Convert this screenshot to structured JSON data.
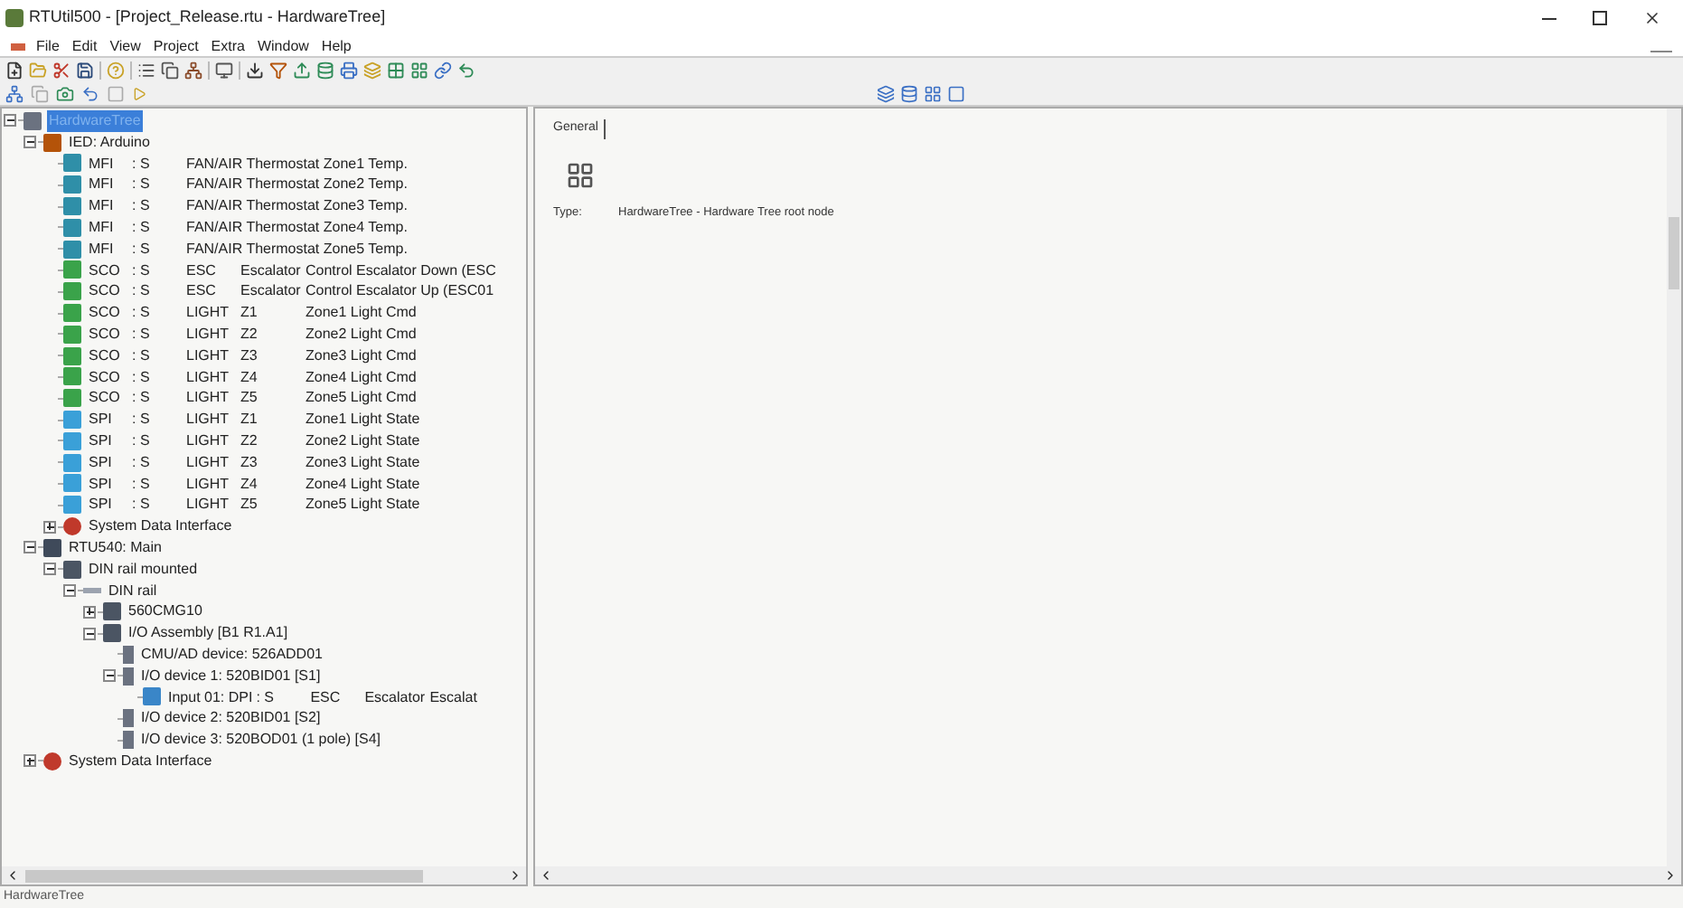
{
  "window": {
    "title": "RTUtil500 - [Project_Release.rtu - HardwareTree]"
  },
  "menu": [
    "File",
    "Edit",
    "View",
    "Project",
    "Extra",
    "Window",
    "Help"
  ],
  "tree": [
    {
      "label": "HardwareTree",
      "kind": "root",
      "selected": true,
      "expanded": true,
      "children": [
        {
          "label": "IED: Arduino",
          "kind": "ied",
          "selected": false,
          "expanded": true,
          "children": [
            {
              "cols": [
                "MFI",
                ": S",
                "FAN/AIR Thermostat Zone1 Temp."
              ],
              "kind": "mfi",
              "selected": false
            },
            {
              "cols": [
                "MFI",
                ": S",
                "FAN/AIR Thermostat Zone2 Temp."
              ],
              "kind": "mfi",
              "selected": false
            },
            {
              "cols": [
                "MFI",
                ": S",
                "FAN/AIR Thermostat Zone3 Temp."
              ],
              "kind": "mfi",
              "selected": false
            },
            {
              "cols": [
                "MFI",
                ": S",
                "FAN/AIR Thermostat Zone4 Temp."
              ],
              "kind": "mfi",
              "selected": false
            },
            {
              "cols": [
                "MFI",
                ": S",
                "FAN/AIR Thermostat Zone5 Temp."
              ],
              "kind": "mfi",
              "selected": false
            },
            {
              "cols": [
                "SCO",
                ": S",
                "ESC",
                "Escalator",
                "Control Escalator Down (ESC"
              ],
              "kind": "sco",
              "selected": false
            },
            {
              "cols": [
                "SCO",
                ": S",
                "ESC",
                "Escalator",
                "Control Escalator Up (ESC01"
              ],
              "kind": "sco",
              "selected": false
            },
            {
              "cols": [
                "SCO",
                ": S",
                "LIGHT",
                "Z1",
                "Zone1 Light Cmd"
              ],
              "kind": "sco",
              "selected": false
            },
            {
              "cols": [
                "SCO",
                ": S",
                "LIGHT",
                "Z2",
                "Zone2 Light Cmd"
              ],
              "kind": "sco",
              "selected": false
            },
            {
              "cols": [
                "SCO",
                ": S",
                "LIGHT",
                "Z3",
                "Zone3 Light Cmd"
              ],
              "kind": "sco",
              "selected": false
            },
            {
              "cols": [
                "SCO",
                ": S",
                "LIGHT",
                "Z4",
                "Zone4 Light Cmd"
              ],
              "kind": "sco",
              "selected": false
            },
            {
              "cols": [
                "SCO",
                ": S",
                "LIGHT",
                "Z5",
                "Zone5 Light Cmd"
              ],
              "kind": "sco",
              "selected": false
            },
            {
              "cols": [
                "SPI",
                ": S",
                "LIGHT",
                "Z1",
                "Zone1 Light State"
              ],
              "kind": "spi",
              "selected": false
            },
            {
              "cols": [
                "SPI",
                ": S",
                "LIGHT",
                "Z2",
                "Zone2 Light State"
              ],
              "kind": "spi",
              "selected": false
            },
            {
              "cols": [
                "SPI",
                ": S",
                "LIGHT",
                "Z3",
                "Zone3 Light State"
              ],
              "kind": "spi",
              "selected": false
            },
            {
              "cols": [
                "SPI",
                ": S",
                "LIGHT",
                "Z4",
                "Zone4 Light State"
              ],
              "kind": "spi",
              "selected": false
            },
            {
              "cols": [
                "SPI",
                ": S",
                "LIGHT",
                "Z5",
                "Zone5 Light State"
              ],
              "kind": "spi",
              "selected": false
            },
            {
              "label": "System Data Interface",
              "kind": "sdi",
              "selected": false,
              "expanded": false
            }
          ]
        },
        {
          "label": "RTU540: Main",
          "kind": "rtu",
          "selected": false,
          "expanded": true,
          "children": [
            {
              "label": "DIN rail mounted",
              "kind": "module",
              "selected": false,
              "expanded": true,
              "children": [
                {
                  "label": "DIN rail",
                  "kind": "rail",
                  "selected": false,
                  "expanded": true,
                  "children": [
                    {
                      "label": "560CMG10",
                      "kind": "module",
                      "selected": false,
                      "expanded": false
                    },
                    {
                      "label": "I/O Assembly [B1 R1.A1]",
                      "kind": "module",
                      "selected": false,
                      "expanded": true,
                      "children": [
                        {
                          "label": "CMU/AD device: 526ADD01",
                          "kind": "device",
                          "selected": false
                        },
                        {
                          "label": "I/O device 1: 520BID01 [S1]",
                          "kind": "device",
                          "selected": false,
                          "expanded": true,
                          "children": [
                            {
                              "cols": [
                                "Input 01: DPI",
                                ": S",
                                "ESC",
                                "Escalator",
                                "Escalat"
                              ],
                              "kind": "input",
                              "selected": false
                            }
                          ]
                        },
                        {
                          "label": "I/O device 2: 520BID01 [S2]",
                          "kind": "device",
                          "selected": false
                        },
                        {
                          "label": "I/O device 3: 520BOD01 (1 pole) [S4]",
                          "kind": "device",
                          "selected": false
                        }
                      ]
                    }
                  ]
                }
              ]
            }
          ]
        },
        {
          "label": "System Data Interface",
          "kind": "sdi",
          "selected": false,
          "expanded": false
        }
      ]
    }
  ],
  "details": {
    "tabs": [
      {
        "label": "General",
        "selected": true
      }
    ],
    "type_label": "Type:",
    "type_value": "HardwareTree - Hardware Tree root node"
  },
  "status_bar": "HardwareTree"
}
